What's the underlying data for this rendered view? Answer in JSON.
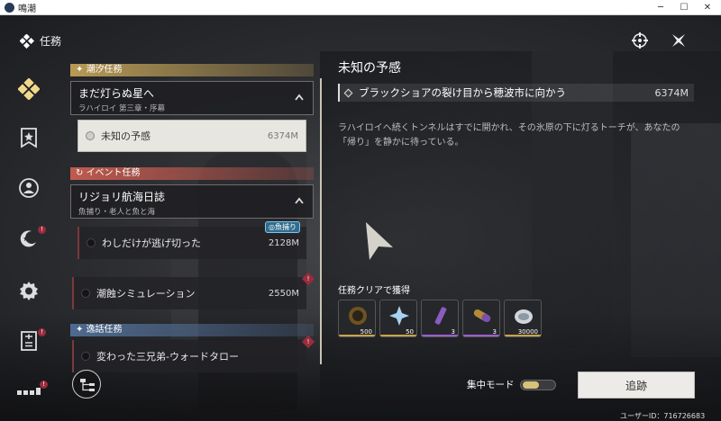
{
  "window": {
    "title": "鳴潮"
  },
  "header": {
    "title": "任務"
  },
  "quest_list": {
    "sections": [
      {
        "name": "潮汐任務",
        "group": {
          "title": "まだ灯らぬ星へ",
          "subtitle": "ラハイロイ 第三章・序幕"
        },
        "quests": [
          {
            "name": "未知の予感",
            "distance": "6374M",
            "selected": true
          }
        ]
      },
      {
        "name": "イベント任務",
        "group": {
          "title": "リジョリ航海日誌",
          "subtitle": "魚捕り・老人と魚と海"
        },
        "quests": [
          {
            "name": "わしだけが逃げ切った",
            "distance": "2128M",
            "tag": "魚捕り"
          },
          {
            "name": "潮蝕シミュレーション",
            "distance": "2550M",
            "badge": "!"
          }
        ]
      },
      {
        "name": "逸話任務",
        "quests": [
          {
            "name": "変わった三兄弟-ウォードタロー",
            "badge": "!"
          }
        ]
      }
    ]
  },
  "detail": {
    "title": "未知の予感",
    "objective": {
      "text": "ブラックショアの裂け目から穂波市に向かう",
      "distance": "6374M"
    },
    "description": "ラハイロイへ続くトンネルはすでに開かれ、その氷原の下に灯るトーチが、あなたの「帰り」を静かに待っている。"
  },
  "rewards": {
    "label": "任務クリアで獲得",
    "items": [
      {
        "icon": "gear-coin-icon",
        "qty": "500",
        "color": "#c9a44b"
      },
      {
        "icon": "star-crystal-icon",
        "qty": "50",
        "color": "#c9a44b"
      },
      {
        "icon": "purple-vial-icon",
        "qty": "3",
        "color": "#9b5fd0"
      },
      {
        "icon": "purple-capsule-icon",
        "qty": "3",
        "color": "#9b5fd0"
      },
      {
        "icon": "shell-icon",
        "qty": "30000",
        "color": "#c9a44b"
      }
    ]
  },
  "focus_mode": {
    "label": "集中モード",
    "enabled": true
  },
  "track_button": {
    "label": "追跡"
  },
  "user_id": "ユーザーID：716726683",
  "badge_mark": "!"
}
